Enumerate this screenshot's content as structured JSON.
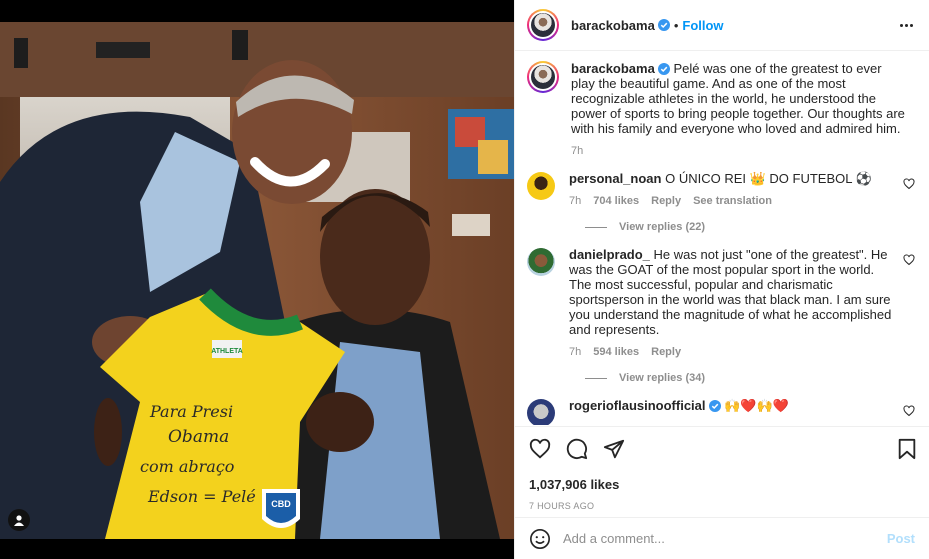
{
  "post": {
    "username": "barackobama",
    "follow_label": "Follow",
    "caption": {
      "username": "barackobama",
      "text": "Pelé was one of the greatest to ever play the beautiful game. And as one of the most recognizable athletes in the world, he understood the power of sports to bring people together. Our thoughts are with his family and everyone who loved and admired him.",
      "time": "7h"
    },
    "photo": {
      "jersey_brand": "ATHLETA",
      "crest": "CBD",
      "signature_lines": [
        "Para Presi",
        "Obama",
        "com abraço",
        "Edson = Pelé"
      ]
    }
  },
  "comments": [
    {
      "username": "personal_noan",
      "text": "O ÚNICO REI 👑 DO FUTEBOL ⚽",
      "time": "7h",
      "likes": "704 likes",
      "reply": "Reply",
      "translate": "See translation",
      "view_replies": "View replies (22)"
    },
    {
      "username": "danielprado_",
      "text": "He was not just \"one of the greatest\". He was the GOAT of the most popular sport in the world. The most successful, popular and charismatic sportsperson in the world was that black man. I am sure you understand the magnitude of what he accomplished and represents.",
      "time": "7h",
      "likes": "594 likes",
      "reply": "Reply",
      "view_replies": "View replies (34)"
    },
    {
      "username": "rogerioflausinoofficial",
      "text": "🙌❤️🙌❤️"
    }
  ],
  "stats": {
    "likes": "1,037,906 likes",
    "ago": "7 HOURS AGO"
  },
  "composer": {
    "placeholder": "Add a comment...",
    "post_label": "Post"
  },
  "colors": {
    "accent": "#0095f6",
    "verified": "#3897f0",
    "post_disabled": "#b2dffc",
    "muted": "#8e8e8e"
  }
}
